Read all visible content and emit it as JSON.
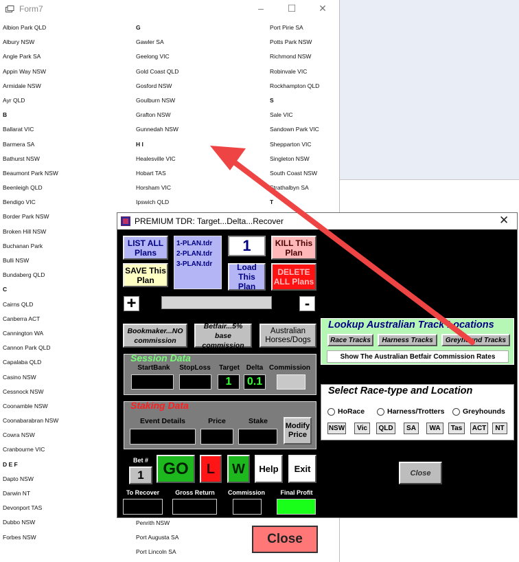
{
  "form7": {
    "title": "Form7",
    "columns": [
      [
        "Albion Park  QLD",
        "Albury  NSW",
        "Angle Park  SA",
        "Appin Way  NSW",
        "Armidale  NSW",
        "Ayr  QLD",
        "B",
        "Ballarat  VIC",
        "Barmera  SA",
        "Bathurst  NSW",
        "Beaumont Park  NSW",
        "Beenleigh  QLD",
        "Bendigo  VIC",
        "Border Park  NSW",
        "Broken Hill  NSW",
        "Buchanan Park",
        "Bulli  NSW",
        "Bundaberg  QLD",
        "C",
        "Cairns  QLD",
        "Canberra  ACT",
        "Cannington  WA",
        "Cannon Park  QLD",
        "Capalaba  QLD",
        "Casino  NSW",
        "Cessnock  NSW",
        "Coonamble  NSW",
        "Coonabarabran  NSW",
        "Cowra  NSW",
        "Cranbourne  VIC",
        "D  E  F",
        "Dapto  NSW",
        "Darwin  NT",
        "Devonport  TAS",
        "Dubbo  NSW",
        "Forbes  NSW"
      ],
      [
        "G",
        "Gawler  SA",
        "Geelong  VIC",
        "Gold Coast  QLD",
        "Gosford  NSW",
        "Goulburn  NSW",
        "Grafton  NSW",
        "Gunnedah  NSW",
        "H   I",
        "Healesville  VIC",
        "Hobart  TAS",
        "Horsham  VIC",
        "Ipswich  QLD"
      ],
      [
        "Port Pirie  SA",
        "Potts Park  NSW",
        "Richmond  NSW",
        "Robinvale  VIC",
        "Rockhampton  QLD",
        "S",
        "Sale  VIC",
        "Sandown Park  VIC",
        "Shepparton  VIC",
        "Singleton  NSW",
        "South Coast  NSW",
        "Strathalbyn  SA",
        "T"
      ]
    ],
    "col2_bottom": [
      "Penrith  NSW",
      "Port Augusta  SA",
      "Port Lincoln  SA"
    ],
    "headers": [
      "B",
      "C",
      "D  E  F",
      "G",
      "H   I",
      "S",
      "T"
    ]
  },
  "premium": {
    "title": "PREMIUM TDR:    Target...Delta...Recover",
    "list_all_plans": "LIST ALL Plans",
    "save_plan": "SAVE This Plan",
    "plans": [
      "1-PLAN.tdr",
      "2-PLAN.tdr",
      "3-PLAN.tdr"
    ],
    "plan_number": "1",
    "kill_plan": "KILL  This Plan",
    "load_plan": "Load This Plan",
    "delete_all": "DELETE ALL Plans",
    "plus": "+",
    "minus": "-",
    "bookmaker": "Bookmaker...NO commission",
    "betfair": "Betfair...5% base commission",
    "australian": "Australian Horses/Dogs",
    "session": {
      "title": "Session Data",
      "startbank": "StartBank",
      "stoploss": "StopLoss",
      "target": "Target",
      "delta": "Delta",
      "commission": "Commission",
      "target_value": "1",
      "delta_value": "0.1"
    },
    "staking": {
      "title": "Staking Data",
      "event": "Event Details",
      "price": "Price",
      "stake": "Stake",
      "modify": "Modify Price"
    },
    "bet_label": "Bet #",
    "bet_value": "1",
    "go": "GO",
    "l": "L",
    "w": "W",
    "help": "Help",
    "exit": "Exit",
    "to_recover": "To Recover",
    "gross_return": "Gross Return",
    "commission": "Commission",
    "final_profit": "Final Profit",
    "lookup": {
      "title": "Lookup Australian Track Locations",
      "race": "Race Tracks",
      "harness": "Harness Tracks",
      "grey": "Greyhound Tracks",
      "rates": "Show The Australian Betfair Commission Rates"
    },
    "select": {
      "title": "Select Race-type and Location",
      "horace": "HoRace",
      "harness": "Harness/Trotters",
      "greyhounds": "Greyhounds",
      "states": [
        "NSW",
        "Vic",
        "QLD",
        "SA",
        "WA",
        "Tas",
        "ACT",
        "NT"
      ]
    },
    "close_small": "Close"
  },
  "close_big": "Close",
  "colors": {
    "arrow": "#ef4444",
    "go": "#1db81d",
    "lookup": "#b6f7b6"
  }
}
